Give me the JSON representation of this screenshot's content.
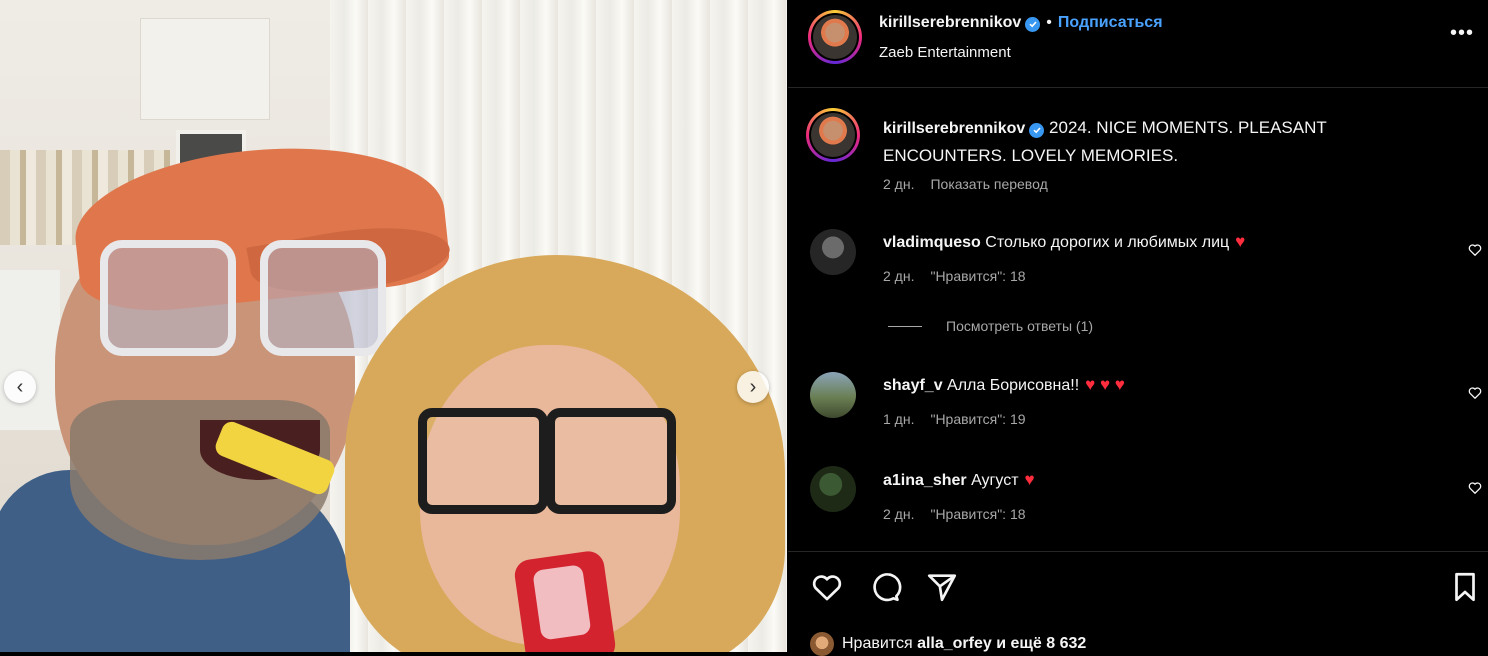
{
  "post": {
    "carousel_prev": "‹",
    "carousel_next": "›"
  },
  "header": {
    "username": "kirillserebrennikov",
    "separator": "•",
    "follow_label": "Подписаться",
    "subtitle": "Zaeb Entertainment",
    "more_label": "•••"
  },
  "caption": {
    "username": "kirillserebrennikov",
    "text": "2024. NICE MOMENTS. PLEASANT ENCOUNTERS. LOVELY MEMORIES.",
    "time": "2 дн.",
    "translate_label": "Показать перевод"
  },
  "comments": [
    {
      "username": "vladimqueso",
      "text": "Столько дорогих и любимых лиц",
      "hearts": "♥",
      "time": "2 дн.",
      "likes": "\"Нравится\": 18"
    },
    {
      "username": "shayf_v",
      "text": "Алла Борисовна!!",
      "hearts": "♥ ♥ ♥",
      "time": "1 дн.",
      "likes": "\"Нравится\": 19"
    },
    {
      "username": "a1ina_sher",
      "text": "Аугуст",
      "hearts": "♥",
      "time": "2 дн.",
      "likes": "\"Нравится\": 18"
    }
  ],
  "view_replies_label": "Посмотреть ответы (1)",
  "likes": {
    "prefix": "Нравится",
    "user": "alla_orfey",
    "suffix": "и ещё 8 632"
  },
  "colors": {
    "background": "#000000",
    "link_blue": "#4aa2ff",
    "verified_blue": "#3897f0",
    "heart_red": "#ff2d3d",
    "muted_text": "#a8a8a8"
  },
  "icons": [
    "verified-icon",
    "more-icon",
    "like-icon",
    "comment-icon",
    "share-icon",
    "save-icon",
    "heart-icon",
    "chevron-left-icon",
    "chevron-right-icon"
  ]
}
